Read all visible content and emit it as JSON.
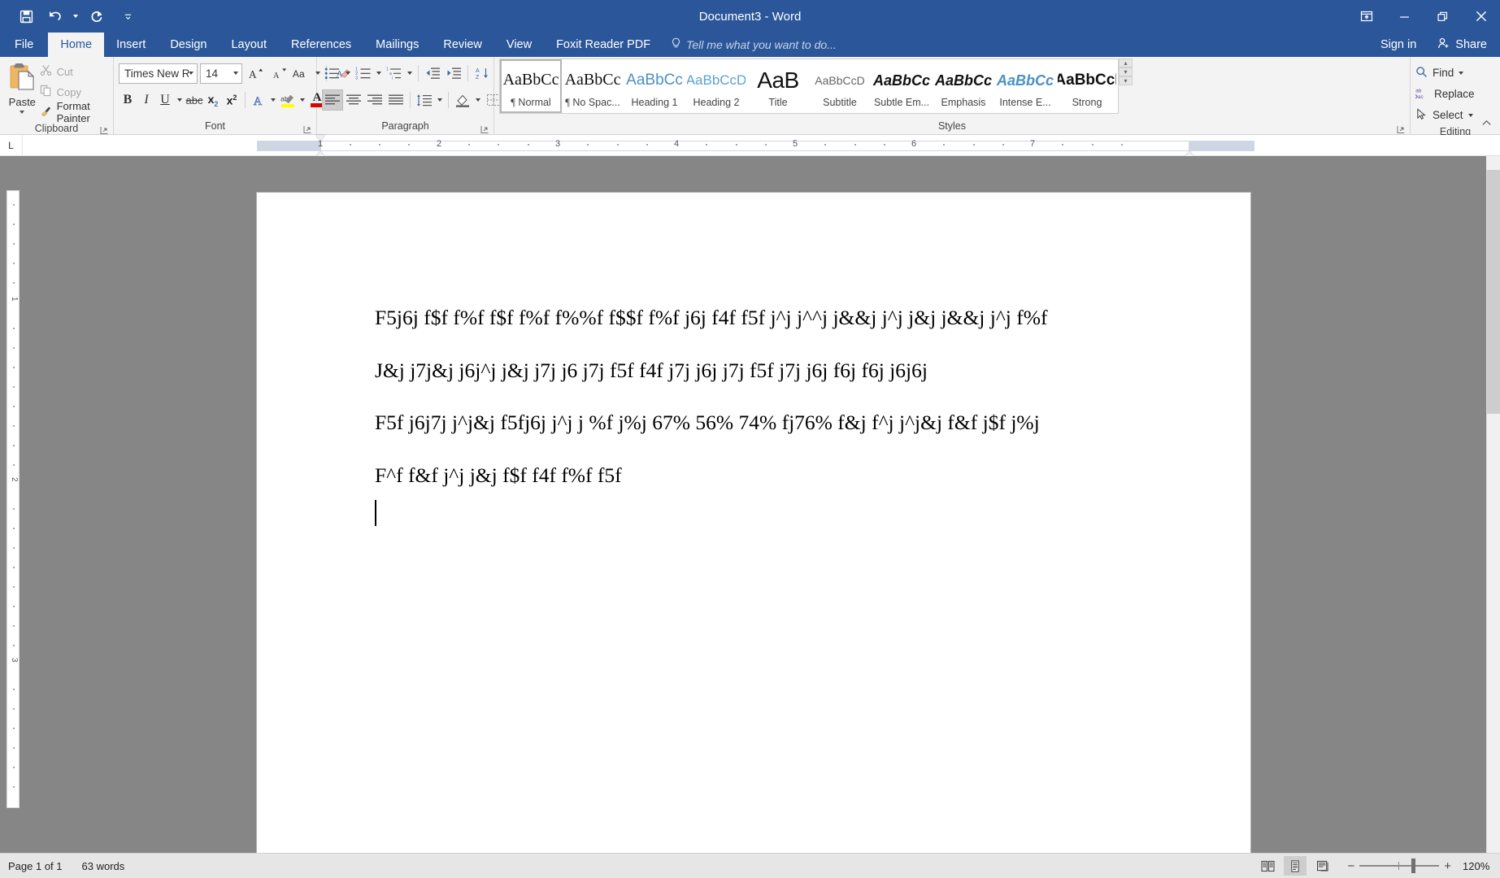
{
  "titlebar": {
    "document_title": "Document3 - Word",
    "quick_access": [
      {
        "name": "save",
        "label": "Save"
      },
      {
        "name": "undo",
        "label": "Undo"
      },
      {
        "name": "redo",
        "label": "Redo"
      },
      {
        "name": "customize",
        "label": "Customize Quick Access Toolbar"
      }
    ],
    "ribbon_display_options": "Ribbon Display Options",
    "minimize": "Minimize",
    "restore": "Restore Down",
    "close": "Close"
  },
  "tabs": [
    {
      "label": "File",
      "active": false,
      "kind": "file"
    },
    {
      "label": "Home",
      "active": true
    },
    {
      "label": "Insert",
      "active": false
    },
    {
      "label": "Design",
      "active": false
    },
    {
      "label": "Layout",
      "active": false
    },
    {
      "label": "References",
      "active": false
    },
    {
      "label": "Mailings",
      "active": false
    },
    {
      "label": "Review",
      "active": false
    },
    {
      "label": "View",
      "active": false
    },
    {
      "label": "Foxit Reader PDF",
      "active": false
    }
  ],
  "tell_me": "Tell me what you want to do...",
  "account": {
    "sign_in": "Sign in",
    "share": "Share"
  },
  "ribbon": {
    "clipboard": {
      "label": "Clipboard",
      "paste": "Paste",
      "cut": "Cut",
      "copy": "Copy",
      "format_painter": "Format Painter"
    },
    "font": {
      "label": "Font",
      "font_name": "Times New R",
      "font_name_full": "Times New Roman",
      "font_size": "14",
      "grow_font": "Increase Font Size",
      "shrink_font": "Decrease Font Size",
      "change_case": "Aa",
      "clear_formatting": "Clear All Formatting",
      "bold": "B",
      "italic": "I",
      "underline": "U",
      "strikethrough": "abc",
      "subscript": "x",
      "superscript": "x",
      "text_effects": "A",
      "highlight": "Text Highlight Color",
      "font_color": "A"
    },
    "paragraph": {
      "label": "Paragraph",
      "bullets": "Bullets",
      "numbering": "Numbering",
      "multilevel": "Multilevel List",
      "decrease_indent": "Decrease Indent",
      "increase_indent": "Increase Indent",
      "sort": "Sort",
      "show_marks": "¶",
      "align_left": "Align Left",
      "align_center": "Center",
      "align_right": "Align Right",
      "justify": "Justify",
      "line_spacing": "Line and Paragraph Spacing",
      "shading": "Shading",
      "borders": "Borders",
      "active_alignment": "align_left"
    },
    "styles": {
      "label": "Styles",
      "items": [
        {
          "name": "Normal",
          "preview": "AaBbCc",
          "mark": "¶",
          "cls": "sp-normal",
          "selected": true
        },
        {
          "name": "No Spac...",
          "preview": "AaBbCc",
          "mark": "¶",
          "cls": "sp-nospace",
          "selected": false
        },
        {
          "name": "Heading 1",
          "preview": "AaBbCc",
          "mark": "",
          "cls": "sp-h1",
          "selected": false
        },
        {
          "name": "Heading 2",
          "preview": "AaBbCcD",
          "mark": "",
          "cls": "sp-h2",
          "selected": false
        },
        {
          "name": "Title",
          "preview": "AaB",
          "mark": "",
          "cls": "sp-title",
          "selected": false
        },
        {
          "name": "Subtitle",
          "preview": "AaBbCcD",
          "mark": "",
          "cls": "sp-sub",
          "selected": false
        },
        {
          "name": "Subtle Em...",
          "preview": "AaBbCc",
          "mark": "",
          "cls": "sp-subem",
          "selected": false
        },
        {
          "name": "Emphasis",
          "preview": "AaBbCc",
          "mark": "",
          "cls": "sp-em",
          "selected": false
        },
        {
          "name": "Intense E...",
          "preview": "AaBbCc",
          "mark": "",
          "cls": "sp-iem",
          "selected": false
        },
        {
          "name": "Strong",
          "preview": "AaBbCcI",
          "mark": "",
          "cls": "sp-strong",
          "selected": false
        }
      ]
    },
    "editing": {
      "label": "Editing",
      "find": "Find",
      "replace": "Replace",
      "select": "Select"
    }
  },
  "ruler": {
    "tabstop_marker": "L",
    "h_numbers": [
      "1",
      "2",
      "3",
      "4",
      "5",
      "6",
      "7"
    ]
  },
  "document": {
    "lines": [
      "F5j6j f$f f%f f$f f%f f%%f f$$f f%f j6j f4f f5f j^j j^^j j&&j j^j j&j j&&j j^j f%f",
      "J&j j7j&j j6j^j j&j j7j j6 j7j f5f f4f j7j j6j j7j f5f j7j j6j f6j f6j j6j6j",
      "F5f j6j7j j^j&j f5fj6j j^j j %f j%j 67% 56% 74% fj76% f&j f^j j^j&j f&f j$f j%j",
      "F^f f&f j^j j&j f$f f4f f%f f5f"
    ]
  },
  "statusbar": {
    "page_info": "Page 1 of 1",
    "word_count": "63 words",
    "view_read": "Read Mode",
    "view_print": "Print Layout",
    "view_web": "Web Layout",
    "zoom_out": "−",
    "zoom_in": "+",
    "zoom_level": "120%"
  },
  "colors": {
    "word_blue": "#2b579a",
    "ribbon_bg": "#f3f3f3",
    "workspace_gray": "#868686",
    "accent_heading": "#4a90c4"
  }
}
